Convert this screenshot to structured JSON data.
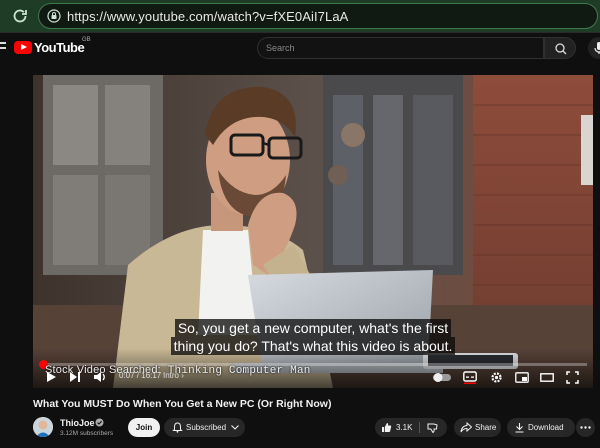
{
  "browser": {
    "url": "https://www.youtube.com/watch?v=fXE0AiI7LaA"
  },
  "masthead": {
    "logo_text": "YouTube",
    "region": "GB",
    "search_placeholder": "Search"
  },
  "player": {
    "captions": [
      "So, you get a new computer, what's the first",
      "thing you do? That's what this video is about."
    ],
    "watermark_label": "Stock Video Searched:",
    "watermark_value": "Thinking Computer Man",
    "time": "0:07 / 16:17",
    "chapter": "Intro",
    "progress_fraction": 0.007
  },
  "video": {
    "title": "What You MUST Do When You Get a New PC (Or Right Now)"
  },
  "channel": {
    "name": "ThioJoe",
    "subscribers": "3.12M subscribers"
  },
  "actions": {
    "join": "Join",
    "subscribed": "Subscribed",
    "likes": "3.1K",
    "share": "Share",
    "download": "Download"
  },
  "colors": {
    "accent": "#ff0000",
    "browser_bar": "#1f3d26",
    "page_bg": "#0f0f0f"
  },
  "icons": [
    "reload-icon",
    "lock-icon",
    "menu-icon",
    "youtube-logo-icon",
    "search-icon",
    "mic-icon",
    "play-icon",
    "next-icon",
    "volume-icon",
    "autoplay-toggle-icon",
    "subtitles-icon",
    "settings-icon",
    "miniplayer-icon",
    "theater-icon",
    "fullscreen-icon",
    "verified-icon",
    "bell-icon",
    "like-icon",
    "dislike-icon",
    "share-icon",
    "download-icon",
    "more-icon"
  ]
}
